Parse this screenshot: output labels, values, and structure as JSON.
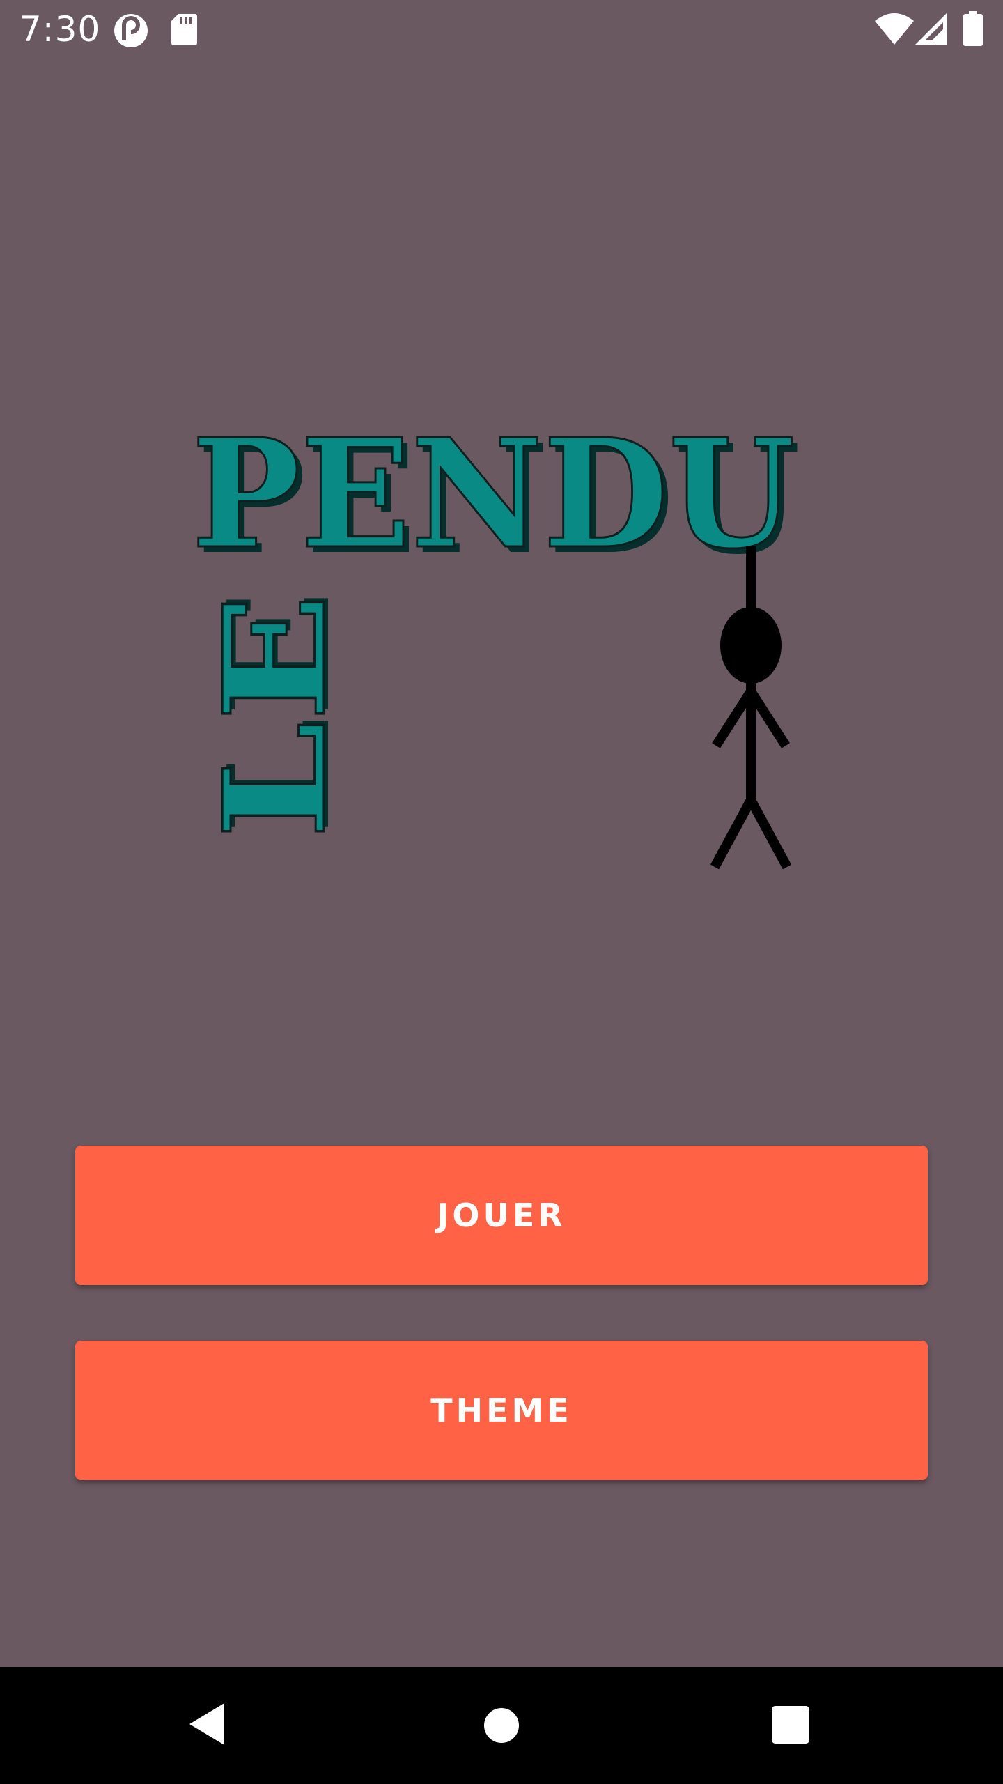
{
  "status_bar": {
    "time": "7:30",
    "icons": [
      "pocket-casts-icon",
      "sd-card-icon",
      "wifi-icon",
      "signal-icon",
      "battery-icon"
    ]
  },
  "logo": {
    "title": "PENDU",
    "subtitle": "LE",
    "title_color": "#0a8a84"
  },
  "menu": {
    "play_label": "JOUER",
    "theme_label": "THEME",
    "button_color": "#ff6245"
  },
  "nav_bar": {
    "icons": [
      "back-icon",
      "home-icon",
      "recents-icon"
    ]
  },
  "colors": {
    "background": "#6b5961"
  }
}
